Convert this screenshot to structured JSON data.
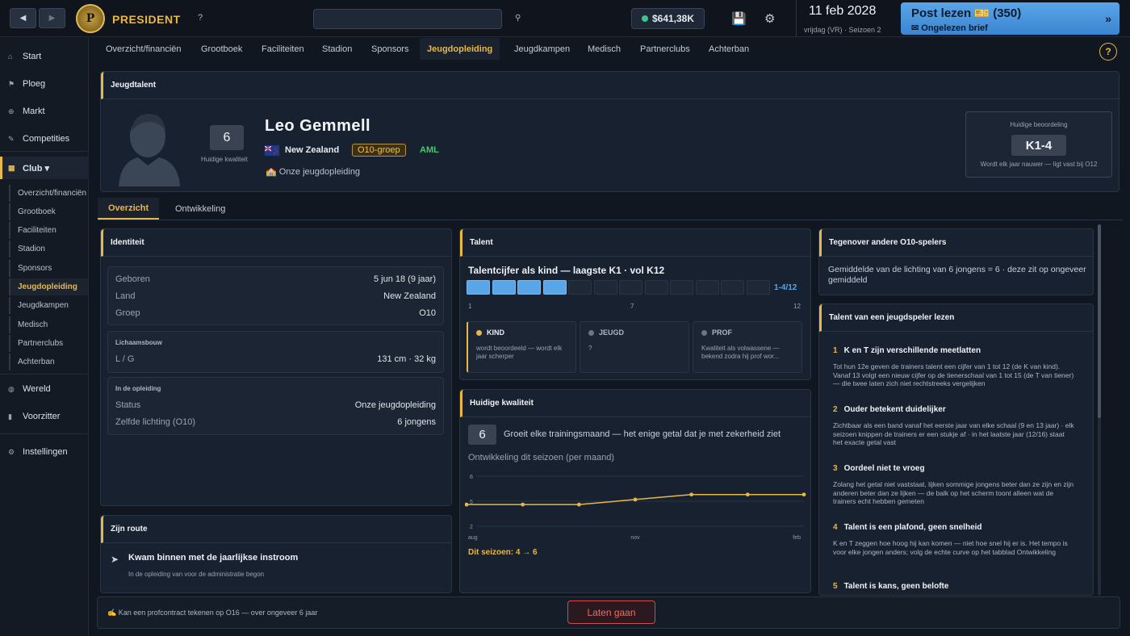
{
  "topbar": {
    "back_label": "◀",
    "forward_label": "▶",
    "logo_letter": "P",
    "brand": "PRESIDENT",
    "help_q": "?",
    "money": "$641,38K",
    "date": "11 feb 2028",
    "date_sub": "vrijdag (VR) · Seizoen 2",
    "post_title": "Post lezen 🎫 (350)",
    "post_sub": "✉ Ongelezen brief",
    "post_chevron": "»"
  },
  "sidebar": {
    "items": [
      {
        "label": "Start",
        "icon": "⌂"
      },
      {
        "label": "Ploeg",
        "icon": "⚑"
      },
      {
        "label": "Markt",
        "icon": "⊕"
      },
      {
        "label": "Competities",
        "icon": "✎"
      },
      {
        "label": "Club ▾",
        "icon": "▦"
      },
      {
        "label": "Wereld",
        "icon": "◍"
      },
      {
        "label": "Voorzitter",
        "icon": "▮"
      },
      {
        "label": "Instellingen",
        "icon": "⚙"
      }
    ],
    "sub": [
      "Overzicht/financiën",
      "Grootboek",
      "Faciliteiten",
      "Stadion",
      "Sponsors",
      "Jeugdopleiding",
      "Jeugdkampen",
      "Medisch",
      "Partnerclubs",
      "Achterban"
    ]
  },
  "tabs": [
    "Overzicht/financiën",
    "Grootboek",
    "Faciliteiten",
    "Stadion",
    "Sponsors",
    "Jeugdopleiding",
    "Jeugdkampen",
    "Medisch",
    "Partnerclubs",
    "Achterban"
  ],
  "help": "?",
  "header": {
    "title": "Jeugdtalent",
    "quality": "6",
    "quality_label": "Huidige kwaliteit",
    "name": "Leo Gemmell",
    "country": "New Zealand",
    "group": "O10-groep",
    "position": "AML",
    "academy": "🏫 Onze jeugdopleiding",
    "rating_label": "Huidige beoordeling",
    "rating": "K1-4",
    "rating_note": "Wordt elk jaar nauwer — ligt vast bij O12"
  },
  "subtabs": [
    "Overzicht",
    "Ontwikkeling"
  ],
  "identity": {
    "title": "Identiteit",
    "rows": [
      [
        "Geboren",
        "5 jun 18 (9 jaar)"
      ],
      [
        "Land",
        "New Zealand"
      ],
      [
        "Groep",
        "O10"
      ]
    ],
    "build_title": "Lichaamsbouw",
    "build_row": [
      "L / G",
      "131 cm · 32 kg"
    ],
    "training_title": "In de opleiding",
    "training_rows": [
      [
        "Status",
        "Onze jeugdopleiding"
      ],
      [
        "Zelfde lichting (O10)",
        "6 jongens"
      ]
    ]
  },
  "route": {
    "title": "Zijn route",
    "headline": "Kwam binnen met de jaarlijkse instroom",
    "sub": "In de opleiding van voor de administratie begon"
  },
  "talent": {
    "title": "Talent",
    "subtitle": "Talentcijfer als kind — laagste K1 · vol K12",
    "range_label": "1-4/12",
    "scale": {
      "min": 1,
      "max": 12,
      "filled_low": 1,
      "filled_high": 4
    },
    "ticks": [
      "1",
      "7",
      "12"
    ],
    "stages": [
      {
        "name": "KIND",
        "text": "wordt beoordeeld — wordt elk jaar scherper",
        "color": "#e7b845"
      },
      {
        "name": "JEUGD",
        "text": "?",
        "color": "#6b7584"
      },
      {
        "name": "PROF",
        "text": "Kwaliteit als volwassene — bekend zodra hij prof wor...",
        "color": "#6b7584"
      }
    ]
  },
  "current": {
    "title": "Huidige kwaliteit",
    "value": "6",
    "text": "Groeit elke trainingsmaand — het enige getal dat je met zekerheid ziet",
    "chart_title": "Ontwikkeling dit seizoen (per maand)",
    "season_label": "Dit seizoen: 4 → 6"
  },
  "chart_data": {
    "type": "line",
    "x": [
      "aug",
      "sep",
      "okt",
      "nov",
      "dec",
      "jan",
      "feb"
    ],
    "series": [
      {
        "values": [
          4.6,
          4.6,
          4.6,
          5.2,
          5.8,
          5.8,
          5.8
        ]
      }
    ],
    "ylim": [
      2,
      8
    ],
    "y_ticks": [
      "8",
      "5",
      "2"
    ],
    "x_ticks": [
      "aug",
      "nov",
      "feb"
    ],
    "grid": true,
    "color": "#e7b845"
  },
  "compare": {
    "title": "Tegenover andere O10-spelers",
    "text": "Gemiddelde van de lichting van 6 jongens = 6 · deze zit op ongeveer gemiddeld"
  },
  "guide": {
    "title": "Talent van een jeugdspeler lezen",
    "items": [
      {
        "n": "1",
        "h": "K en T zijn verschillende meetlatten",
        "b": "Tot hun 12e geven de trainers talent een cijfer van 1 tot 12 (de K van kind). Vanaf 13 volgt een nieuw cijfer op de tienerschaal van 1 tot 15 (de T van tiener) — die twee laten zich niet rechtstreeks vergelijken"
      },
      {
        "n": "2",
        "h": "Ouder betekent duidelijker",
        "b": "Zichtbaar als een band vanaf het eerste jaar van elke schaal (9 en 13 jaar) · elk seizoen knippen de trainers er een stukje af · in het laatste jaar (12/16) staat het exacte getal vast"
      },
      {
        "n": "3",
        "h": "Oordeel niet te vroeg",
        "b": "Zolang het getal niet vaststaat, lijken sommige jongens beter dan ze zijn en zijn anderen beter dan ze lijken — de balk op het scherm toont alleen wat de trainers echt hebben gemeten"
      },
      {
        "n": "4",
        "h": "Talent is een plafond, geen snelheid",
        "b": "K en T zeggen hoe hoog hij kan komen — niet hoe snel hij er is. Het tempo is voor elke jongen anders; volg de echte curve op het tabblad Ontwikkeling"
      },
      {
        "n": "5",
        "h": "Talent is kans, geen belofte",
        "b": ""
      }
    ]
  },
  "footer": {
    "note": "✍ Kan een profcontract tekenen op O16 — over ongeveer 6 jaar",
    "release": "Laten gaan"
  }
}
